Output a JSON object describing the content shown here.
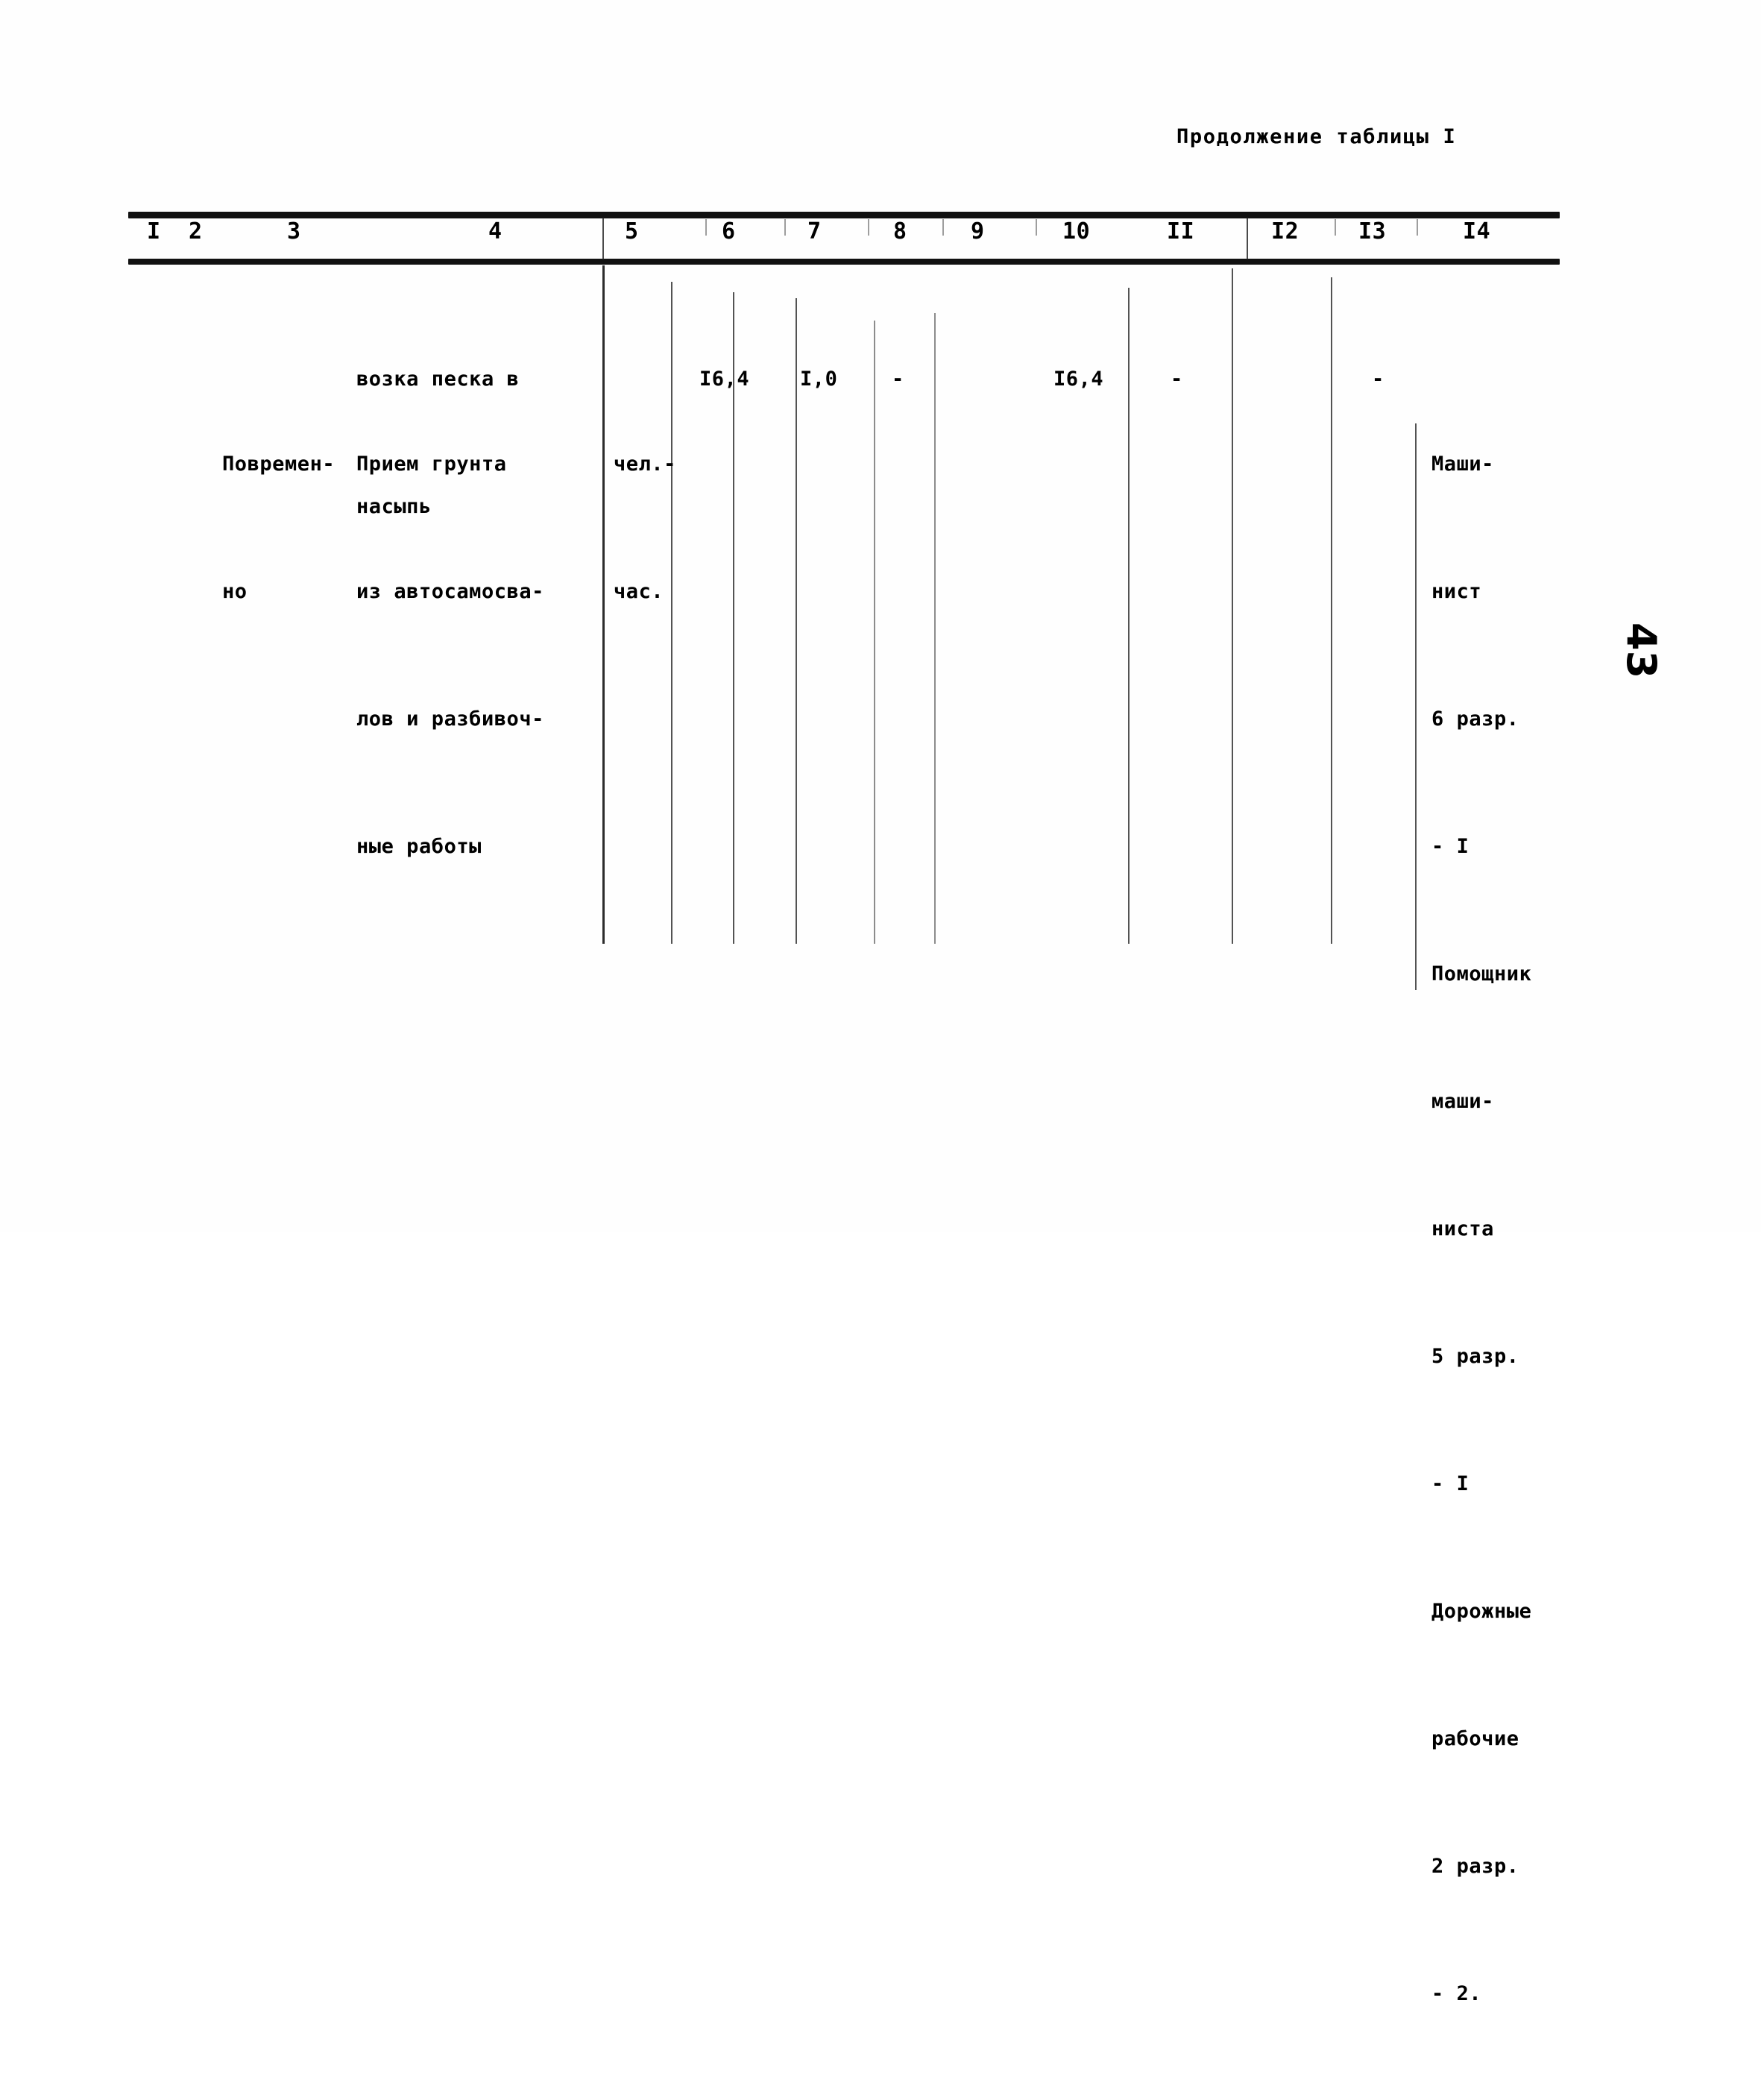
{
  "document": {
    "caption": "Продолжение таблицы I",
    "page_number": "43"
  },
  "table": {
    "column_headers": [
      "I",
      "2",
      "3",
      "4",
      "5",
      "6",
      "7",
      "8",
      "9",
      "10",
      "II",
      "I2",
      "I3",
      "I4"
    ],
    "carryover_row": {
      "col4_lines": [
        "возка песка в",
        "насыпь"
      ]
    },
    "rows": [
      {
        "col3_lines": [
          "Повремен-",
          "но"
        ],
        "col4_lines": [
          "Прием грунта",
          "из автосамосва-",
          "лов и разбивоч-",
          "ные работы"
        ],
        "col5_lines": [
          "чел.-",
          "час."
        ],
        "col6": "I6,4",
        "col7": "I,0",
        "col8": "-",
        "col9": "",
        "col10": "I6,4",
        "col11": "-",
        "col12": "",
        "col13": "-",
        "col14_lines": [
          "Маши-",
          "нист",
          "6 разр.",
          "- I",
          "Помощник",
          "маши-",
          "ниста",
          "5 разр.",
          "- I",
          "Дорожные",
          "рабочие",
          "2 разр.",
          "- 2."
        ]
      }
    ]
  }
}
